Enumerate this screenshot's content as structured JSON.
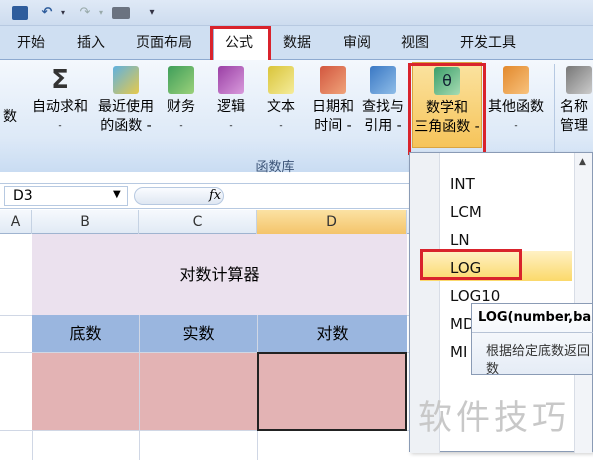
{
  "ribbon_tabs": {
    "start": "开始",
    "insert": "插入",
    "layout": "页面布局",
    "formulas": "公式",
    "data": "数据",
    "review": "审阅",
    "view": "视图",
    "developer": "开发工具"
  },
  "ribbon": {
    "partial_left": "数",
    "autosum": [
      "自动求和",
      "-"
    ],
    "recent": [
      "最近使用",
      "的函数 -"
    ],
    "financial": [
      "财务",
      "-"
    ],
    "logical": [
      "逻辑",
      "-"
    ],
    "text": [
      "文本",
      "-"
    ],
    "datetime": [
      "日期和",
      "时间 -"
    ],
    "lookup": [
      "查找与",
      "引用 -"
    ],
    "mathtrig": [
      "数学和",
      "三角函数 -"
    ],
    "more": [
      "其他函数",
      "-"
    ],
    "name_mgr": [
      "名称",
      "管理"
    ],
    "group_label": "函数库"
  },
  "formula_bar": {
    "name_box": "D3",
    "fx": "fx"
  },
  "columns": [
    "A",
    "B",
    "C",
    "D"
  ],
  "sheet": {
    "title": "对数计算器",
    "headers": [
      "底数",
      "实数",
      "对数"
    ]
  },
  "dropdown": {
    "items": [
      "INT",
      "LCM",
      "LN",
      "LOG",
      "LOG10",
      "MD",
      "MI"
    ],
    "selected": "LOG"
  },
  "tooltip": {
    "signature": "LOG(number,ba",
    "desc1": "根据给定底数返回",
    "desc2": "数"
  },
  "watermark": "软件技巧",
  "colors": {
    "accent_red": "#d9232c",
    "header_blue": "#9ab6df",
    "cell_pink": "#e3b3b4",
    "title_bg": "#ebe1ee",
    "selected_item": "#fde38c"
  }
}
